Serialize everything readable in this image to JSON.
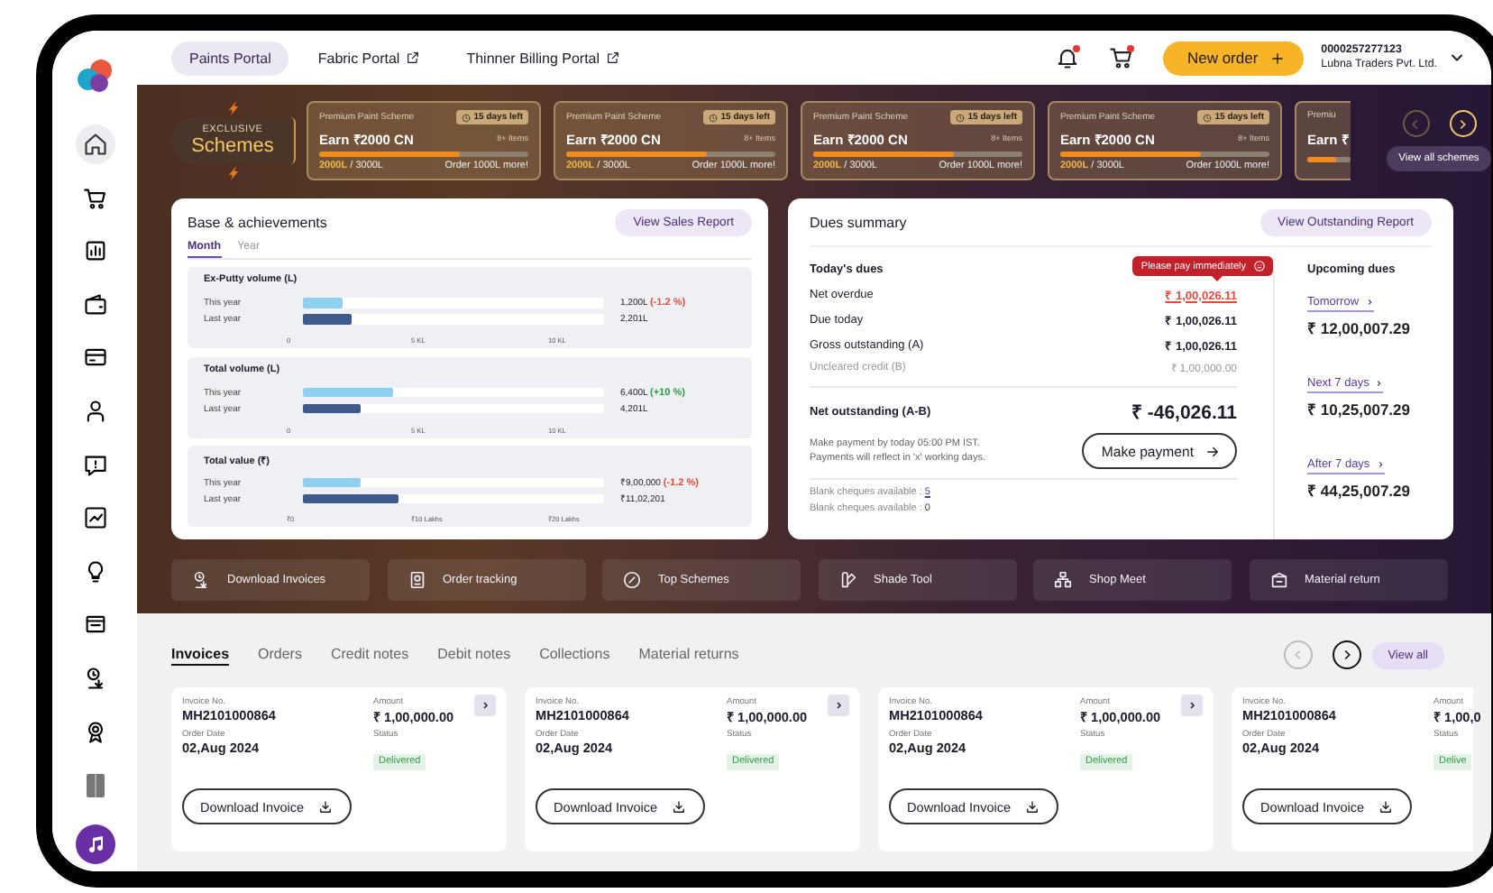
{
  "sidebar": {
    "items": [
      {
        "kind": "home",
        "selected": true
      },
      {
        "kind": "cart",
        "selected": false
      },
      {
        "kind": "bar-chart",
        "selected": false
      },
      {
        "kind": "wallet",
        "selected": false
      },
      {
        "kind": "card",
        "selected": false
      },
      {
        "kind": "person",
        "selected": false
      },
      {
        "kind": "chat",
        "selected": false
      },
      {
        "kind": "line-chart",
        "selected": false
      },
      {
        "kind": "bulb",
        "selected": false
      },
      {
        "kind": "document",
        "selected": false
      },
      {
        "kind": "download",
        "selected": false
      },
      {
        "kind": "award",
        "selected": false
      },
      {
        "kind": "panel",
        "selected": false
      },
      {
        "kind": "music",
        "selected": false
      }
    ]
  },
  "top_bar": {
    "portals": [
      {
        "label": "Paints Portal",
        "selected": true,
        "external": false
      },
      {
        "label": "Fabric Portal",
        "selected": false,
        "external": true
      },
      {
        "label": "Thinner Billing Portal",
        "selected": false,
        "external": true
      }
    ],
    "icons": [
      {
        "kind": "bell",
        "badge": true
      },
      {
        "kind": "cart",
        "badge": true
      }
    ],
    "new_order": "New order",
    "account": {
      "id": "0000257277123",
      "name": "Lubna Traders Pvt. Ltd."
    }
  },
  "schemes": {
    "badge_top": "EXCLUSIVE",
    "badge_main": "Schemes",
    "cards": [
      {
        "kind": "full",
        "title": "Premium Paint Scheme",
        "days_left": "15 days left",
        "earn": "Earn ₹2000 CN",
        "items": "8+ Items",
        "level": 0.67,
        "achieved": "2000L",
        "target": "/ 3000L",
        "note": "Order 1000L more!"
      },
      {
        "kind": "full",
        "title": "Premium Paint Scheme",
        "days_left": "15 days left",
        "earn": "Earn ₹2000 CN",
        "items": "8+ Items",
        "level": 0.67,
        "achieved": "2000L",
        "target": "/ 3000L",
        "note": "Order 1000L more!"
      },
      {
        "kind": "full",
        "title": "Premium Paint Scheme",
        "days_left": "15 days left",
        "earn": "Earn ₹2000 CN",
        "items": "8+ Items",
        "level": 0.67,
        "achieved": "2000L",
        "target": "/ 3000L",
        "note": "Order 1000L more!"
      },
      {
        "kind": "full",
        "title": "Premium Paint Scheme",
        "days_left": "15 days left",
        "earn": "Earn ₹2000 CN",
        "items": "8+ Items",
        "level": 0.67,
        "achieved": "2000L",
        "target": "/ 3000L",
        "note": "Order 1000L more!"
      },
      {
        "kind": "partial",
        "title": "Premiu",
        "earn": "Earn ₹",
        "level": 0.67
      }
    ],
    "prev_disabled": true,
    "view_all": "View all schemes"
  },
  "base": {
    "title": "Base & achievements",
    "report_button": "View Sales Report",
    "periods": [
      {
        "label": "Month",
        "selected": true
      },
      {
        "label": "Year",
        "selected": false
      }
    ],
    "metrics": [
      {
        "title": "Ex-Putty volume (L)",
        "ticks": [
          "0",
          "5 KL",
          "10 KL"
        ],
        "rows": [
          {
            "label": "This year",
            "level": 0.13,
            "value": "1,200L",
            "change": "(-1.2 %)",
            "color": "#e54b3c"
          },
          {
            "label": "Last year",
            "level": 0.16,
            "value": "2,201L"
          }
        ]
      },
      {
        "title": "Total volume (L)",
        "ticks": [
          "0",
          "5 KL",
          "10 KL"
        ],
        "rows": [
          {
            "label": "This year",
            "level": 0.3,
            "value": "6,400L",
            "change": "(+10 %)",
            "color": "#2e9c47"
          },
          {
            "label": "Last year",
            "level": 0.19,
            "value": "4,201L"
          }
        ]
      },
      {
        "title": "Total value (₹)",
        "ticks": [
          "₹0",
          "₹10 Lakhs",
          "₹20 Lakhs"
        ],
        "rows": [
          {
            "label": "This year",
            "level": 0.19,
            "value": "₹9,00,000",
            "change": "(-1.2 %)",
            "color": "#e54b3c"
          },
          {
            "label": "Last year",
            "level": 0.32,
            "value": "₹11,02,201"
          }
        ]
      }
    ]
  },
  "dues": {
    "title": "Dues summary",
    "report_button": "View Outstanding Report",
    "today_title": "Today's dues",
    "alert": "Please pay immediately",
    "rows": [
      {
        "kind": "overdue",
        "label": "Net overdue",
        "value": "₹ 1,00,026.11"
      },
      {
        "kind": "normal",
        "label": "Due today",
        "value": "₹ 1,00,026.11"
      },
      {
        "kind": "normal",
        "label": "Gross outstanding (A)",
        "value": "₹ 1,00,026.11"
      },
      {
        "kind": "muted",
        "label": "Uncleared credit (B)",
        "value": "₹ 1,00,000.00"
      }
    ],
    "net_label": "Net outstanding (A-B)",
    "net_value": "₹ -46,026.11",
    "note_lines": [
      "Make payment by today 05:00 PM IST.",
      "Payments will reflect in 'x' working days."
    ],
    "pay_button": "Make payment",
    "cheques": [
      {
        "label": "Blank cheques available :",
        "value": "5",
        "link": true
      },
      {
        "label": "Blank cheques available :",
        "value": "0",
        "link": false
      }
    ],
    "upcoming_title": "Upcoming dues",
    "upcoming": [
      {
        "label": "Tomorrow",
        "amount": "₹ 12,00,007.29"
      },
      {
        "label": "Next 7 days",
        "amount": "₹ 10,25,007.29"
      },
      {
        "label": "After 7 days",
        "amount": "₹ 44,25,007.29"
      }
    ]
  },
  "quick_actions": [
    {
      "kind": "download",
      "label": "Download Invoices"
    },
    {
      "kind": "tracking",
      "label": "Order tracking"
    },
    {
      "kind": "schemes",
      "label": "Top Schemes"
    },
    {
      "kind": "shade",
      "label": "Shade Tool"
    },
    {
      "kind": "meet",
      "label": "Shop Meet"
    },
    {
      "kind": "return",
      "label": "Material return"
    }
  ],
  "documents": {
    "tabs": [
      {
        "label": "Invoices",
        "selected": true
      },
      {
        "label": "Orders",
        "selected": false
      },
      {
        "label": "Credit notes",
        "selected": false
      },
      {
        "label": "Debit notes",
        "selected": false
      },
      {
        "label": "Collections",
        "selected": false
      },
      {
        "label": "Material returns",
        "selected": false
      }
    ],
    "prev_disabled": true,
    "view_all": "View all",
    "cards": [
      {
        "kind": "full",
        "invoice_label": "Invoice No.",
        "invoice_no": "MH2101000864",
        "amount_label": "Amount",
        "amount": "₹ 1,00,000.00",
        "date_label": "Order Date",
        "date": "02,Aug 2024",
        "status_label": "Status",
        "status": "Delivered",
        "download": "Download Invoice"
      },
      {
        "kind": "full",
        "invoice_label": "Invoice No.",
        "invoice_no": "MH2101000864",
        "amount_label": "Amount",
        "amount": "₹ 1,00,000.00",
        "date_label": "Order Date",
        "date": "02,Aug 2024",
        "status_label": "Status",
        "status": "Delivered",
        "download": "Download Invoice"
      },
      {
        "kind": "full",
        "invoice_label": "Invoice No.",
        "invoice_no": "MH2101000864",
        "amount_label": "Amount",
        "amount": "₹ 1,00,000.00",
        "date_label": "Order Date",
        "date": "02,Aug 2024",
        "status_label": "Status",
        "status": "Delivered",
        "download": "Download Invoice"
      },
      {
        "kind": "partial",
        "invoice_label": "Invoice No.",
        "invoice_no": "MH2101000864",
        "amount_label": "Amount",
        "amount": "₹ 1,00,0",
        "date_label": "Order Date",
        "date": "02,Aug 2024",
        "status_label": "Status",
        "status": "Delive",
        "download": "Download Invoice"
      }
    ]
  }
}
